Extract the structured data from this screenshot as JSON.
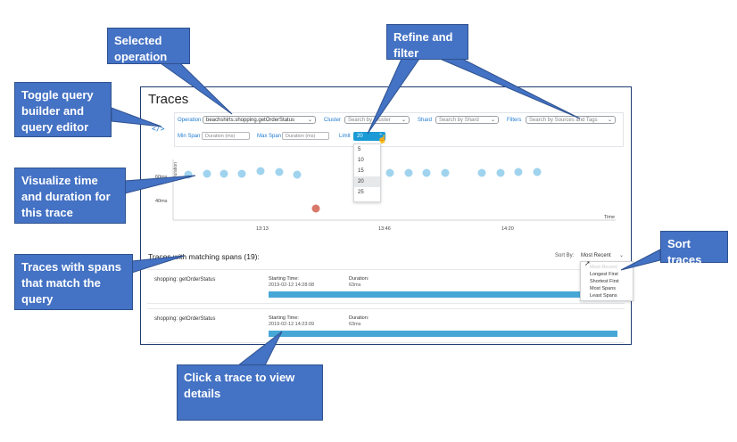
{
  "page": {
    "title": "Traces",
    "toggle_icon": "</>"
  },
  "query": {
    "operation_label": "Operation",
    "operation_value": "beachshirts.shopping.getOrderStatus",
    "cluster_label": "Cluster",
    "cluster_placeholder": "Search by Cluster",
    "shard_label": "Shard",
    "shard_placeholder": "Search by Shard",
    "filters_label": "Filters",
    "filters_placeholder": "Search by Sources and Tags",
    "min_span_label": "Min Span",
    "min_span_placeholder": "Duration (ms)",
    "max_span_label": "Max Span",
    "max_span_placeholder": "Duration (ms)",
    "limit_label": "Limit",
    "limit_value": "20",
    "limit_options": [
      "5",
      "10",
      "15",
      "20",
      "25"
    ],
    "limit_selected_index": 3
  },
  "chart": {
    "y_axis_label": "Duration",
    "y_ticks": [
      "60ms",
      "40ms"
    ],
    "x_ticks": [
      "13:13",
      "13:46",
      "14:20"
    ],
    "x_axis_label": "Time"
  },
  "results": {
    "title": "Traces with matching spans (19):",
    "sort_by_label": "Sort By:",
    "sort_by_value": "Most Recent",
    "sort_options": [
      "Most Recent",
      "Longest First",
      "Shortest First",
      "Most Spans",
      "Least Spans"
    ],
    "traces": [
      {
        "name": "shopping: getOrderStatus",
        "start_label": "Starting Time:",
        "start_value": "2019-02-12 14:28:08",
        "duration_label": "Duration:",
        "duration_value": "63ms"
      },
      {
        "name": "shopping: getOrderStatus",
        "start_label": "Starting Time:",
        "start_value": "2019-02-12 14:23:09",
        "duration_label": "Duration:",
        "duration_value": "63ms"
      }
    ]
  },
  "callouts": {
    "selected_operation": "Selected operation",
    "refine_filter": "Refine and filter",
    "toggle_query": "Toggle query builder and query editor",
    "visualize": "Visualize time and duration for this trace",
    "traces_matching": "Traces with spans that match the query",
    "sort_traces": "Sort traces",
    "click_trace": "Click a trace to view details"
  },
  "colors": {
    "callout_bg": "#4472c4",
    "point_blue": "#9fd3ee",
    "point_red": "#d9796b",
    "bar_blue": "#46a7d7",
    "accent": "#1b9ad6"
  }
}
